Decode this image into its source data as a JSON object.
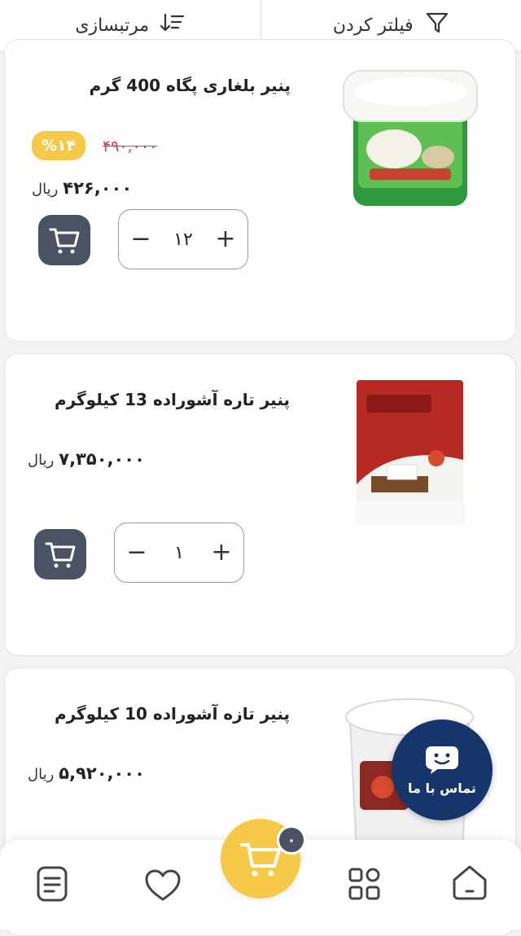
{
  "topbar": {
    "filter_label": "فیلتر کردن",
    "sort_label": "مرتبسازی"
  },
  "products": [
    {
      "title": "پنیر بلغاری پگاه 400 گرم",
      "old_price": "۴۹۰,۰۰۰",
      "discount": "%۱۴",
      "price": "۴۲۶,۰۰۰",
      "currency": "ریال",
      "quantity": "۱۲",
      "image": "cheese-tub-green-icon"
    },
    {
      "title": "پنیر تاره آشوراده 13 کیلوگرم",
      "price": "۷,۳۵۰,۰۰۰",
      "currency": "ریال",
      "quantity": "۱",
      "image": "cheese-tin-red-icon"
    },
    {
      "title": "پنیر تازه آشوراده 10 کیلوگرم",
      "price": "۵,۹۲۰,۰۰۰",
      "currency": "ریال",
      "image": "cheese-bucket-white-icon"
    }
  ],
  "stepper": {
    "minus": "−",
    "plus": "+"
  },
  "cart": {
    "count": "۰"
  },
  "contact": {
    "label": "تماس با ما"
  },
  "nav": {
    "icons": [
      "home-icon",
      "categories-icon",
      "cart-icon",
      "favorites-icon",
      "orders-icon"
    ]
  },
  "colors": {
    "accent_yellow": "#f7c948",
    "dark_button": "#4a5263",
    "contact_blue": "#16366b",
    "old_price_red": "#e0384b"
  }
}
